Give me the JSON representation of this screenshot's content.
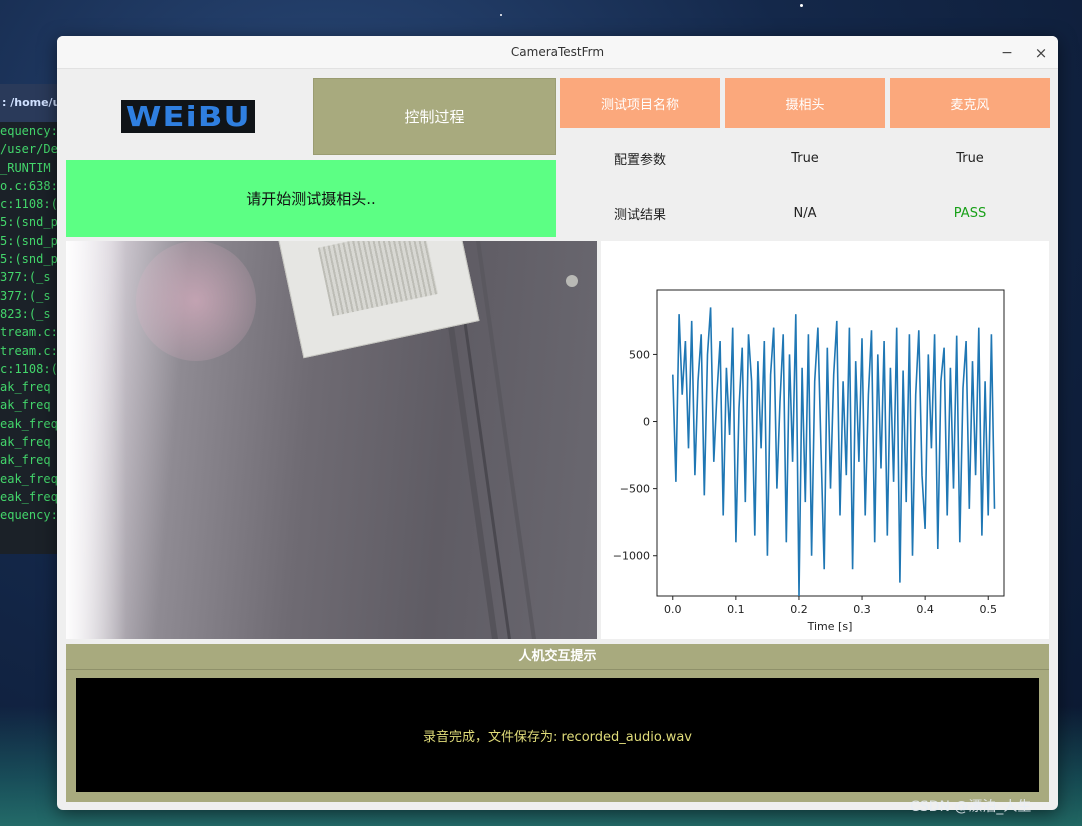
{
  "terminal": {
    "title": ": /home/us",
    "lines": [
      "equency:",
      "/user/De",
      "_RUNTIM",
      "o.c:638:",
      "c:1108:(",
      "5:(snd_p",
      "5:(snd_p",
      "5:(snd_p",
      " 377:(_s",
      " 377:(_s",
      " 823:(_s",
      "tream.c:",
      "tream.c:",
      "c:1108:(",
      "ak_freq",
      "ak_freq",
      "eak_freq",
      "ak_freq",
      "ak_freq",
      "eak_freq",
      "eak_freq",
      "equency:"
    ]
  },
  "window": {
    "title": "CameraTestFrm",
    "minimize_glyph": "−",
    "close_glyph": "×"
  },
  "logo": {
    "text": "WEiBU"
  },
  "control": {
    "label": "控制过程"
  },
  "status": {
    "text": "请开始测试摄相头.."
  },
  "table": {
    "headers": [
      "测试项目名称",
      "摄相头",
      "麦克风"
    ],
    "row_config": [
      "配置参数",
      "True",
      "True"
    ],
    "row_result": [
      "测试结果",
      "N/A",
      "PASS"
    ]
  },
  "colors": {
    "header_bg": "#fba87c",
    "olive": "#a8aa7e",
    "status_green": "#5cff84",
    "pass_green": "#18a018",
    "line_blue": "#1f77b4",
    "console_text": "#e0dc7a"
  },
  "chart_data": {
    "type": "line",
    "title": "",
    "xlabel": "Time [s]",
    "ylabel": "",
    "xlim": [
      -0.025,
      0.525
    ],
    "ylim": [
      -1300,
      980
    ],
    "xticks": [
      0.0,
      0.1,
      0.2,
      0.3,
      0.4,
      0.5
    ],
    "xtick_labels": [
      "0.0",
      "0.1",
      "0.2",
      "0.3",
      "0.4",
      "0.5"
    ],
    "yticks": [
      500,
      0,
      -500,
      -1000
    ],
    "ytick_labels": [
      "500",
      "0",
      "−500",
      "−1000"
    ],
    "grid": false,
    "series": [
      {
        "x": [
          0.0,
          0.005,
          0.01,
          0.015,
          0.02,
          0.025,
          0.03,
          0.035,
          0.04,
          0.045,
          0.05,
          0.055,
          0.06,
          0.065,
          0.07,
          0.075,
          0.08,
          0.085,
          0.09,
          0.095,
          0.1,
          0.105,
          0.11,
          0.115,
          0.12,
          0.125,
          0.13,
          0.135,
          0.14,
          0.145,
          0.15,
          0.155,
          0.16,
          0.165,
          0.17,
          0.175,
          0.18,
          0.185,
          0.19,
          0.195,
          0.2,
          0.205,
          0.21,
          0.215,
          0.22,
          0.225,
          0.23,
          0.235,
          0.24,
          0.245,
          0.25,
          0.255,
          0.26,
          0.265,
          0.27,
          0.275,
          0.28,
          0.285,
          0.29,
          0.295,
          0.3,
          0.305,
          0.31,
          0.315,
          0.32,
          0.325,
          0.33,
          0.335,
          0.34,
          0.345,
          0.35,
          0.355,
          0.36,
          0.365,
          0.37,
          0.375,
          0.38,
          0.385,
          0.39,
          0.395,
          0.4,
          0.405,
          0.41,
          0.415,
          0.42,
          0.425,
          0.43,
          0.435,
          0.44,
          0.445,
          0.45,
          0.455,
          0.46,
          0.465,
          0.47,
          0.475,
          0.48,
          0.485,
          0.49,
          0.495,
          0.5,
          0.505,
          0.51
        ],
        "y": [
          350,
          -450,
          800,
          200,
          600,
          -200,
          750,
          -400,
          300,
          650,
          -550,
          500,
          850,
          -300,
          200,
          600,
          -700,
          400,
          -100,
          700,
          -900,
          100,
          550,
          -600,
          650,
          300,
          -850,
          450,
          -200,
          600,
          -1000,
          350,
          700,
          -500,
          150,
          650,
          -900,
          500,
          -300,
          800,
          -1300,
          400,
          -600,
          650,
          -1000,
          300,
          700,
          -200,
          -1100,
          550,
          -500,
          350,
          750,
          -700,
          300,
          -400,
          700,
          -1100,
          450,
          -300,
          620,
          -700,
          200,
          680,
          -900,
          500,
          -350,
          600,
          -850,
          400,
          -450,
          700,
          -1200,
          380,
          -600,
          650,
          -1000,
          200,
          680,
          -400,
          -800,
          500,
          -200,
          650,
          -950,
          300,
          550,
          -700,
          400,
          -500,
          640,
          -900,
          250,
          600,
          -650,
          450,
          -400,
          700,
          -850,
          300,
          -700,
          650,
          -650
        ]
      }
    ]
  },
  "panel": {
    "title": "人机交互提示",
    "message": "录音完成，文件保存为: recorded_audio.wav"
  },
  "watermark": {
    "text": "CSDN @漂泊_人生"
  }
}
